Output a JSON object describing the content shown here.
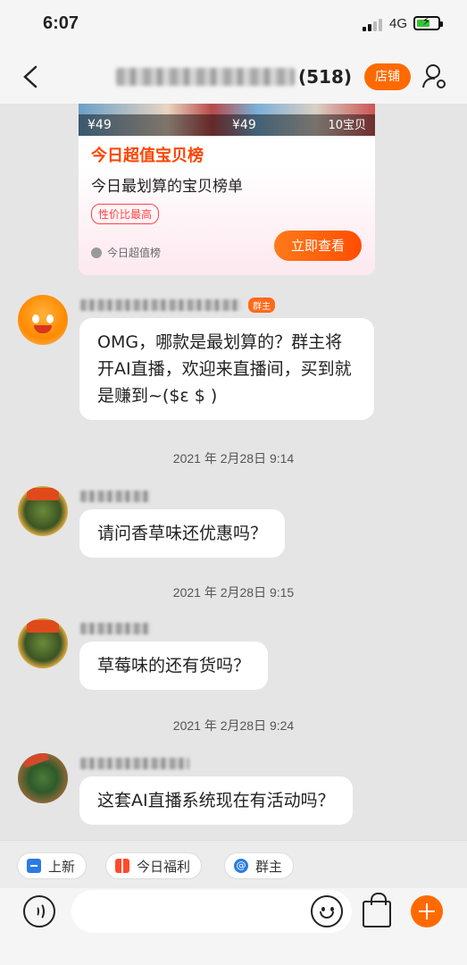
{
  "status_bar": {
    "time": "6:07",
    "network": "4G"
  },
  "header": {
    "title_count": "(518)",
    "shop_label": "店铺"
  },
  "promo_card": {
    "price_1": "¥49",
    "price_2": "¥49",
    "item_count": "10宝贝",
    "title": "今日超值宝贝榜",
    "subtitle": "今日最划算的宝贝榜单",
    "tag": "性价比最高",
    "brand": "今日超值榜",
    "cta": "立即查看"
  },
  "messages": [
    {
      "badge": "群主",
      "text": "OMG，哪款是最划算的？群主将开AI直播，欢迎来直播间，买到就是赚到~($ε $ )"
    },
    {
      "timestamp": "2021 年 2月28日 9:14",
      "text": "请问香草味还优惠吗？"
    },
    {
      "timestamp": "2021 年 2月28日 9:15",
      "text": "草莓味的还有货吗？"
    },
    {
      "timestamp": "2021 年 2月28日 9:24",
      "text": "这套AI直播系统现在有活动吗？"
    }
  ],
  "quick_replies": [
    {
      "label": "上新",
      "icon": "new-arrivals-icon"
    },
    {
      "label": "今日福利",
      "icon": "gift-icon"
    },
    {
      "label": "群主",
      "icon": "at-icon"
    }
  ],
  "colors": {
    "accent": "#ff6a00",
    "bubble": "#ffffff",
    "background": "#e5e5e5"
  }
}
